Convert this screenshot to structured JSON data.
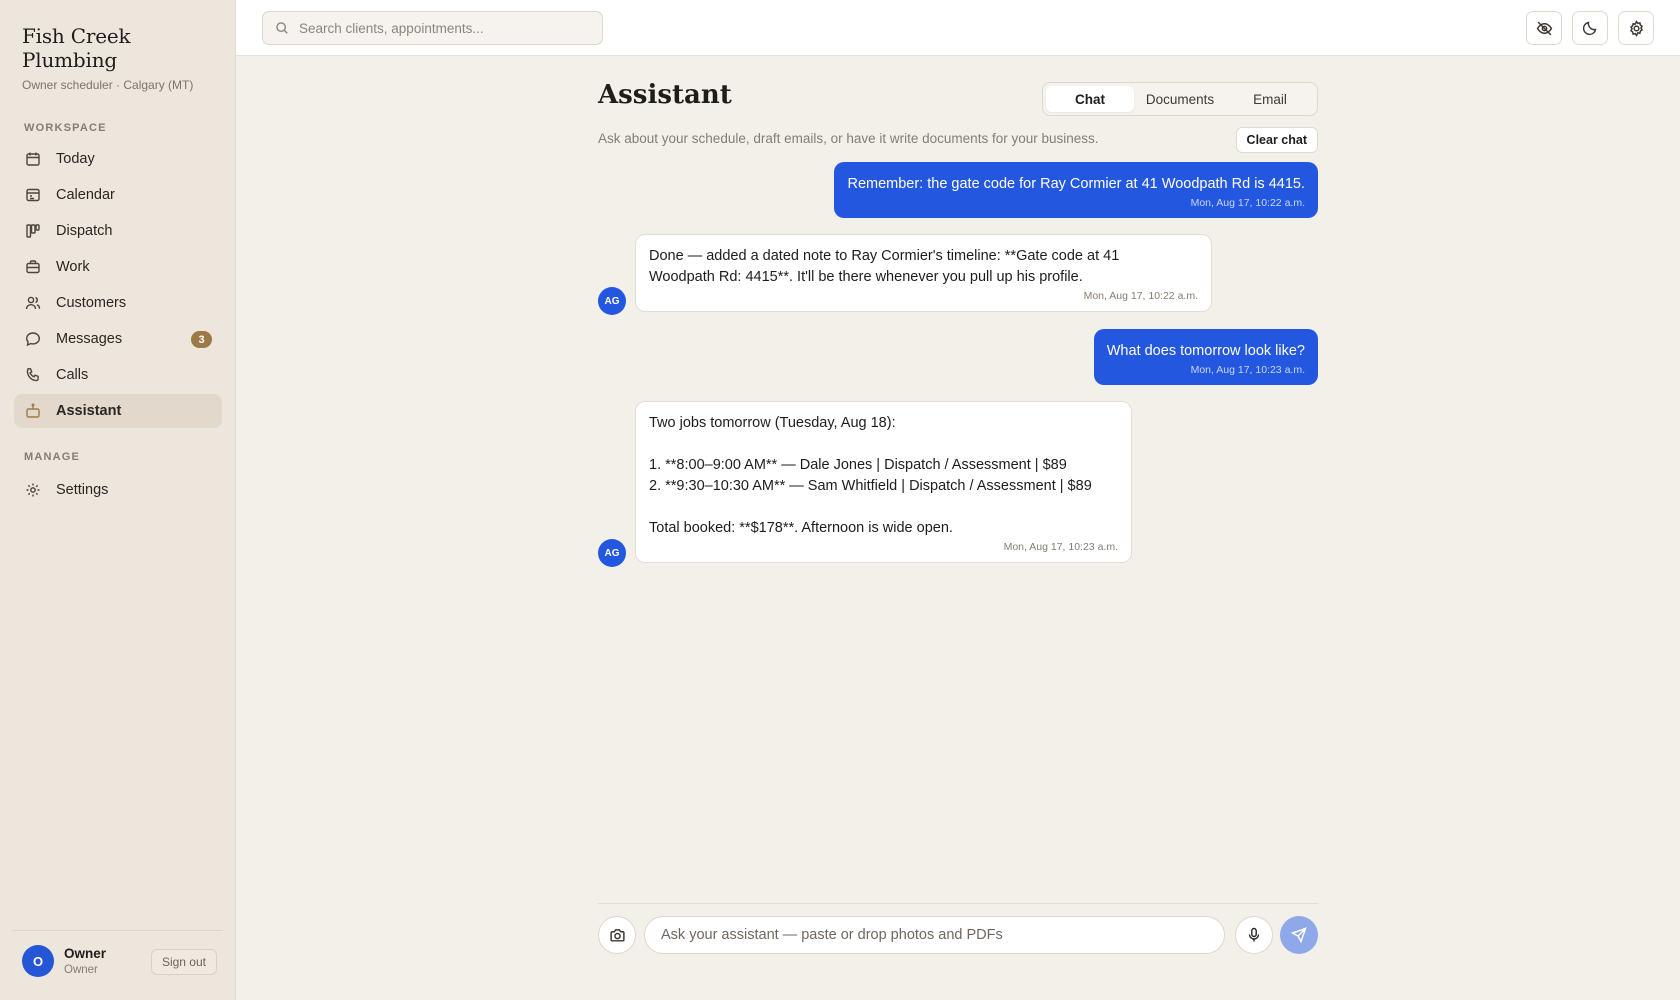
{
  "brand": {
    "name": "Fish Creek Plumbing",
    "subtitle": "Owner scheduler · Calgary (MT)"
  },
  "sidebar": {
    "workspace_label": "WORKSPACE",
    "manage_label": "MANAGE",
    "items": [
      {
        "label": "Today",
        "icon": "calendar-icon"
      },
      {
        "label": "Calendar",
        "icon": "calendar-grid-icon"
      },
      {
        "label": "Dispatch",
        "icon": "kanban-icon"
      },
      {
        "label": "Work",
        "icon": "briefcase-icon"
      },
      {
        "label": "Customers",
        "icon": "users-icon"
      },
      {
        "label": "Messages",
        "icon": "message-icon",
        "badge": "3"
      },
      {
        "label": "Calls",
        "icon": "phone-icon"
      },
      {
        "label": "Assistant",
        "icon": "bot-icon",
        "active": true
      }
    ],
    "manage_items": [
      {
        "label": "Settings",
        "icon": "gear-icon"
      }
    ],
    "user": {
      "initial": "O",
      "name": "Owner",
      "role": "Owner",
      "signout_label": "Sign out"
    }
  },
  "topbar": {
    "search_placeholder": "Search clients, appointments..."
  },
  "main": {
    "title": "Assistant",
    "tabs": [
      "Chat",
      "Documents",
      "Email"
    ],
    "active_tab": "Chat",
    "subtitle": "Ask about your schedule, draft emails, or have it write documents for your business.",
    "clear_label": "Clear chat",
    "bot_initials": "AG",
    "messages": [
      {
        "role": "user",
        "text": "Remember: the gate code for Ray Cormier at 41 Woodpath Rd is 4415.",
        "time": "Mon, Aug 17, 10:22 a.m."
      },
      {
        "role": "assistant",
        "text": "Done — added a dated note to Ray Cormier's timeline: **Gate code at 41\nWoodpath Rd: 4415**. It'll be there whenever you pull up his profile.",
        "time": "Mon, Aug 17, 10:22 a.m."
      },
      {
        "role": "user",
        "text": "What does tomorrow look like?",
        "time": "Mon, Aug 17, 10:23 a.m."
      },
      {
        "role": "assistant",
        "text": "Two jobs tomorrow (Tuesday, Aug 18):\n\n1. **8:00–9:00 AM** — Dale Jones | Dispatch / Assessment | $89\n2. **9:30–10:30 AM** — Sam Whitfield | Dispatch / Assessment | $89\n\nTotal booked: **$178**. Afternoon is wide open.",
        "time": "Mon, Aug 17, 10:23 a.m."
      }
    ],
    "composer_placeholder": "Ask your assistant — paste or drop photos and PDFs"
  },
  "colors": {
    "accent": "#2457e0",
    "badge": "#9c7a45",
    "sidebar_bg": "#ece6dd",
    "page_bg": "#f3f0ea"
  }
}
